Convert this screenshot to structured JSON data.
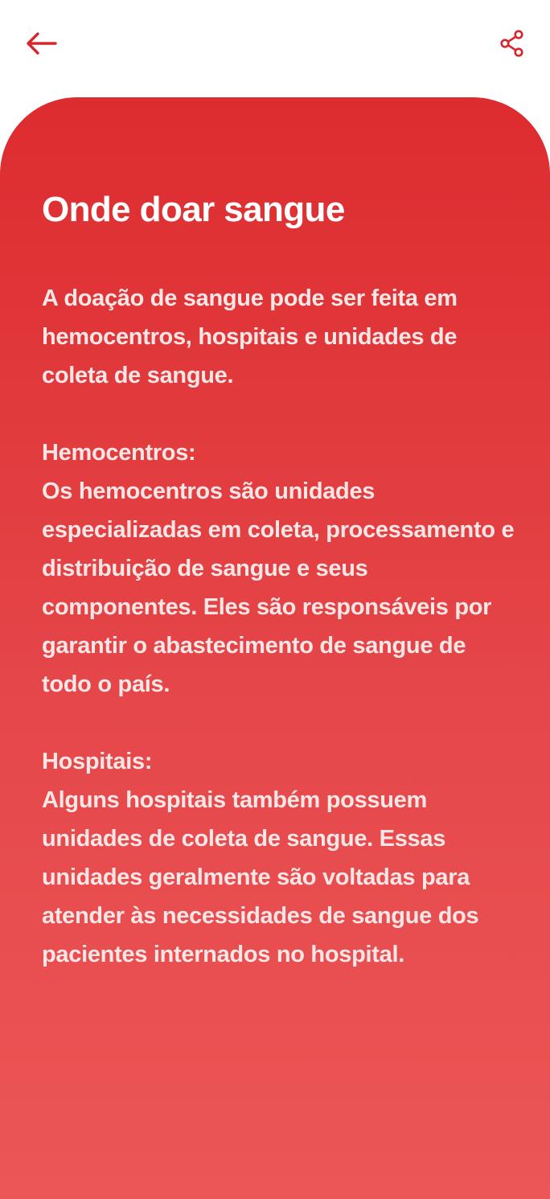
{
  "header": {
    "back_icon": "arrow-left-icon",
    "share_icon": "share-icon",
    "accent_color": "#d8262e"
  },
  "card": {
    "title": "Onde doar sangue",
    "gradient_top": "#dd2c2f",
    "gradient_bottom": "#ec5656",
    "intro": "A doação de sangue pode ser feita em hemocentros, hospitais e unidades de coleta de sangue.",
    "sections": [
      {
        "heading": "Hemocentros:",
        "body": "Os hemocentros são unidades especializadas em coleta, processamento e distribuição de sangue e seus componentes. Eles são responsáveis por garantir o abastecimento de sangue de todo o país."
      },
      {
        "heading": "Hospitais:",
        "body": "Alguns hospitais também possuem unidades de coleta de sangue. Essas unidades geralmente são voltadas para atender às necessidades de sangue dos pacientes internados no hospital."
      }
    ]
  }
}
